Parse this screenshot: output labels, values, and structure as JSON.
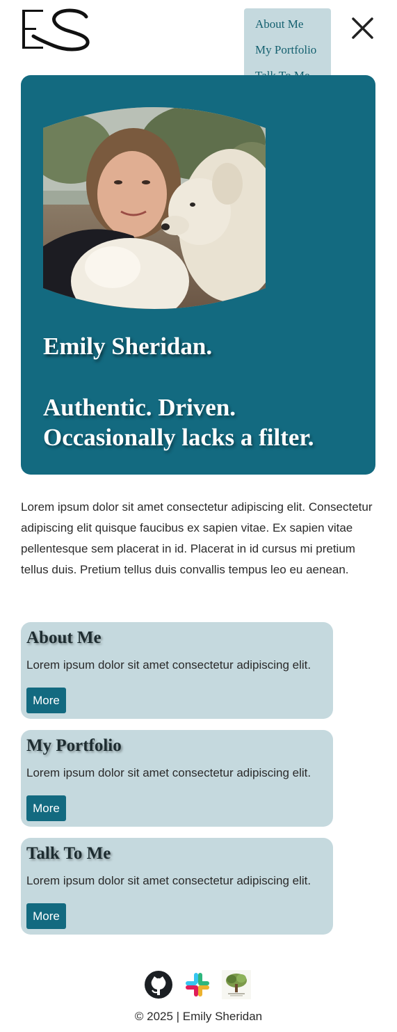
{
  "header": {
    "logo_text": "ES",
    "logo_icon": "es-monogram-logo",
    "close_icon": "close-x-icon"
  },
  "nav": {
    "items": [
      {
        "label": "About Me"
      },
      {
        "label": "My Portfolio"
      },
      {
        "label": "Talk To Me"
      }
    ]
  },
  "hero": {
    "name": "Emily Sheridan.",
    "tagline_1": "Authentic. Driven.",
    "tagline_2": "Occasionally lacks a filter."
  },
  "intro": {
    "text": "Lorem ipsum dolor sit amet consectetur adipiscing elit. Consectetur adipiscing elit quisque faucibus ex sapien vitae. Ex sapien vitae pellentesque sem placerat in id. Placerat in id cursus mi pretium tellus duis. Pretium tellus duis convallis tempus leo eu aenean."
  },
  "cards": [
    {
      "title": "About Me",
      "text": "Lorem ipsum dolor sit amet consectetur adipiscing elit.",
      "button": "More"
    },
    {
      "title": "My Portfolio",
      "text": "Lorem ipsum dolor sit amet consectetur adipiscing elit.",
      "button": "More"
    },
    {
      "title": "Talk To Me",
      "text": "Lorem ipsum dolor sit amet consectetur adipiscing elit.",
      "button": "More"
    }
  ],
  "socials": [
    {
      "icon": "github-icon"
    },
    {
      "icon": "slack-icon"
    },
    {
      "icon": "tree-logo-icon"
    }
  ],
  "footer": {
    "text": "© 2025 | Emily Sheridan"
  },
  "colors": {
    "primary": "#136a80",
    "card_bg": "#c5d9de",
    "dropdown_bg": "#c5d9de",
    "text_dark": "#2a2a2a",
    "white": "#ffffff"
  }
}
